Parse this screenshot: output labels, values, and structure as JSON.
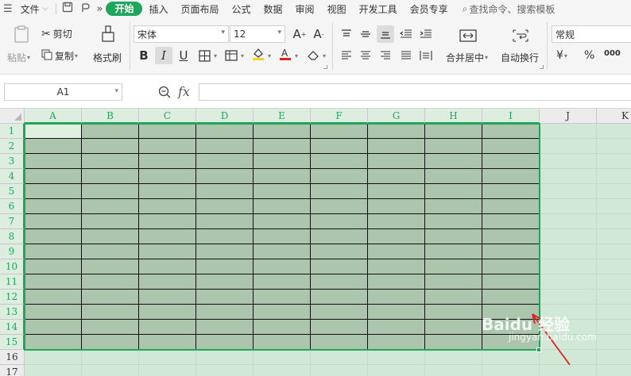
{
  "menubar": {
    "file": "文件",
    "tabs": [
      {
        "label": "开始",
        "active": true
      },
      {
        "label": "插入"
      },
      {
        "label": "页面布局"
      },
      {
        "label": "公式"
      },
      {
        "label": "数据"
      },
      {
        "label": "审阅"
      },
      {
        "label": "视图"
      },
      {
        "label": "开发工具"
      },
      {
        "label": "会员专享"
      }
    ],
    "search_placeholder": "查找命令、搜索模板",
    "more": "»"
  },
  "ribbon": {
    "paste": "粘贴",
    "cut": "剪切",
    "copy": "复制",
    "format_painter": "格式刷",
    "font_name": "宋体",
    "font_size": "12",
    "bold": "B",
    "italic": "I",
    "underline": "U",
    "merge_center": "合并居中",
    "wrap_text": "自动换行",
    "number_format": "常规",
    "currency": "¥",
    "percent": "%",
    "thousands": "000",
    "font_color": "#e02020",
    "fill_color": "#f5d327"
  },
  "formula_bar": {
    "name_box": "A1",
    "fx": "fx",
    "value": ""
  },
  "sheet": {
    "columns": [
      "A",
      "B",
      "C",
      "D",
      "E",
      "F",
      "G",
      "H",
      "I",
      "J",
      "K"
    ],
    "rows": [
      "1",
      "2",
      "3",
      "4",
      "5",
      "6",
      "7",
      "8",
      "9",
      "10",
      "11",
      "12",
      "13",
      "14",
      "15",
      "16",
      "17"
    ],
    "selection": "A1:I15",
    "active_cell": "A1",
    "accent": "#1fa65b"
  },
  "watermark": {
    "brand": "Baidu 经验",
    "url": "jingyan.baidu.com"
  }
}
